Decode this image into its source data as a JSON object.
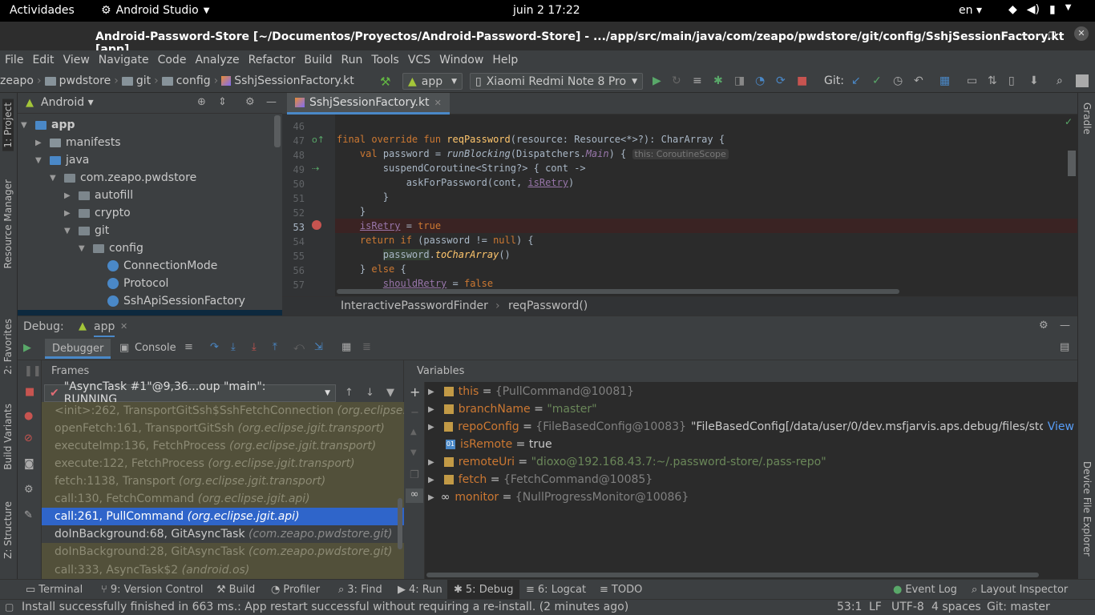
{
  "gnome": {
    "activities": "Actividades",
    "app_name": "Android Studio",
    "clock": "juin 2  17:22",
    "lang": "en"
  },
  "window": {
    "title": "Android-Password-Store [~/Documentos/Proyectos/Android-Password-Store] - .../app/src/main/java/com/zeapo/pwdstore/git/config/SshjSessionFactory.kt [app]"
  },
  "menu": [
    "File",
    "Edit",
    "View",
    "Navigate",
    "Code",
    "Analyze",
    "Refactor",
    "Build",
    "Run",
    "Tools",
    "VCS",
    "Window",
    "Help"
  ],
  "nav": {
    "crumbs": [
      "zeapo",
      "pwdstore",
      "git",
      "config",
      "SshjSessionFactory.kt"
    ],
    "run_config": "app",
    "device": "Xiaomi Redmi Note 8 Pro",
    "git_label": "Git:"
  },
  "left_strip": [
    "1: Project",
    "Resource Manager",
    "2: Favorites",
    "Build Variants",
    "Z: Structure"
  ],
  "right_strip": [
    "Gradle",
    "Device File Explorer"
  ],
  "project": {
    "view": "Android",
    "tree": [
      {
        "label": "app",
        "bold": true
      },
      {
        "label": "manifests"
      },
      {
        "label": "java"
      },
      {
        "label": "com.zeapo.pwdstore"
      },
      {
        "label": "autofill"
      },
      {
        "label": "crypto"
      },
      {
        "label": "git"
      },
      {
        "label": "config"
      },
      {
        "label": "ConnectionMode"
      },
      {
        "label": "Protocol"
      },
      {
        "label": "SshApiSessionFactory"
      }
    ]
  },
  "editor": {
    "tab": "SshjSessionFactory.kt",
    "line_numbers": [
      "46",
      "47",
      "48",
      "49",
      "50",
      "51",
      "52",
      "53",
      "54",
      "55",
      "56",
      "57"
    ],
    "inlay_hint": "this: CoroutineScope",
    "breadcrumb": [
      "InteractivePasswordFinder",
      "reqPassword()"
    ]
  },
  "debug": {
    "label": "Debug:",
    "session": "app",
    "tabs": [
      "Debugger",
      "Console"
    ],
    "frames_title": "Frames",
    "thread": "\"AsyncTask #1\"@9,36...oup \"main\": RUNNING",
    "frames": [
      {
        "method": "<init>:262, TransportGitSsh$SshFetchConnection",
        "pkg": "(org.eclipse.jgit",
        "kind": "lib"
      },
      {
        "method": "openFetch:161, TransportGitSsh",
        "pkg": "(org.eclipse.jgit.transport)",
        "kind": "lib"
      },
      {
        "method": "executeImp:136, FetchProcess",
        "pkg": "(org.eclipse.jgit.transport)",
        "kind": "lib"
      },
      {
        "method": "execute:122, FetchProcess",
        "pkg": "(org.eclipse.jgit.transport)",
        "kind": "lib"
      },
      {
        "method": "fetch:1138, Transport",
        "pkg": "(org.eclipse.jgit.transport)",
        "kind": "lib"
      },
      {
        "method": "call:130, FetchCommand",
        "pkg": "(org.eclipse.jgit.api)",
        "kind": "lib"
      },
      {
        "method": "call:261, PullCommand",
        "pkg": "(org.eclipse.jgit.api)",
        "kind": "selected"
      },
      {
        "method": "doInBackground:68, GitAsyncTask",
        "pkg": "(com.zeapo.pwdstore.git)",
        "kind": "app"
      },
      {
        "method": "doInBackground:28, GitAsyncTask",
        "pkg": "(com.zeapo.pwdstore.git)",
        "kind": "lib"
      },
      {
        "method": "call:333, AsyncTask$2",
        "pkg": "(android.os)",
        "kind": "lib"
      }
    ],
    "variables_title": "Variables",
    "variables": [
      {
        "name": "this",
        "eq": " = ",
        "value": "{PullCommand@10081}",
        "type": "obj"
      },
      {
        "name": "branchName",
        "eq": " = ",
        "value": "\"master\"",
        "type": "str"
      },
      {
        "name": "repoConfig",
        "eq": " = ",
        "value": "{FileBasedConfig@10083}",
        "extra": "\"FileBasedConfig[/data/user/0/dev.msfjarvis.aps.debug/files/sto…",
        "link": "View",
        "type": "obj"
      },
      {
        "name": "isRemote",
        "eq": " = ",
        "value": "true",
        "type": "bool"
      },
      {
        "name": "remoteUri",
        "eq": " = ",
        "value": "\"dioxo@192.168.43.7:~/.password-store/.pass-repo\"",
        "type": "str"
      },
      {
        "name": "fetch",
        "eq": " = ",
        "value": "{FetchCommand@10085}",
        "type": "obj"
      },
      {
        "name": "monitor",
        "eq": " = ",
        "value": "{NullProgressMonitor@10086}",
        "type": "watch"
      }
    ]
  },
  "tool_windows": [
    {
      "label": "Terminal"
    },
    {
      "label": "9: Version Control"
    },
    {
      "label": "Build"
    },
    {
      "label": "Profiler"
    },
    {
      "label": "3: Find"
    },
    {
      "label": "4: Run"
    },
    {
      "label": "5: Debug",
      "active": true
    },
    {
      "label": "6: Logcat"
    },
    {
      "label": "TODO"
    },
    {
      "label": "Event Log"
    },
    {
      "label": "Layout Inspector"
    }
  ],
  "status": {
    "message": "Install successfully finished in 663 ms.: App restart successful without requiring a re-install. (2 minutes ago)",
    "position": "53:1",
    "line_sep": "LF",
    "encoding": "UTF-8",
    "indent": "4 spaces",
    "branch": "Git: master"
  },
  "colors": {
    "accent": "#4a88c7",
    "selection": "#2f65ca",
    "keyword": "#cc7832",
    "function": "#ffc66d",
    "string": "#6a8759",
    "property": "#9876aa"
  }
}
